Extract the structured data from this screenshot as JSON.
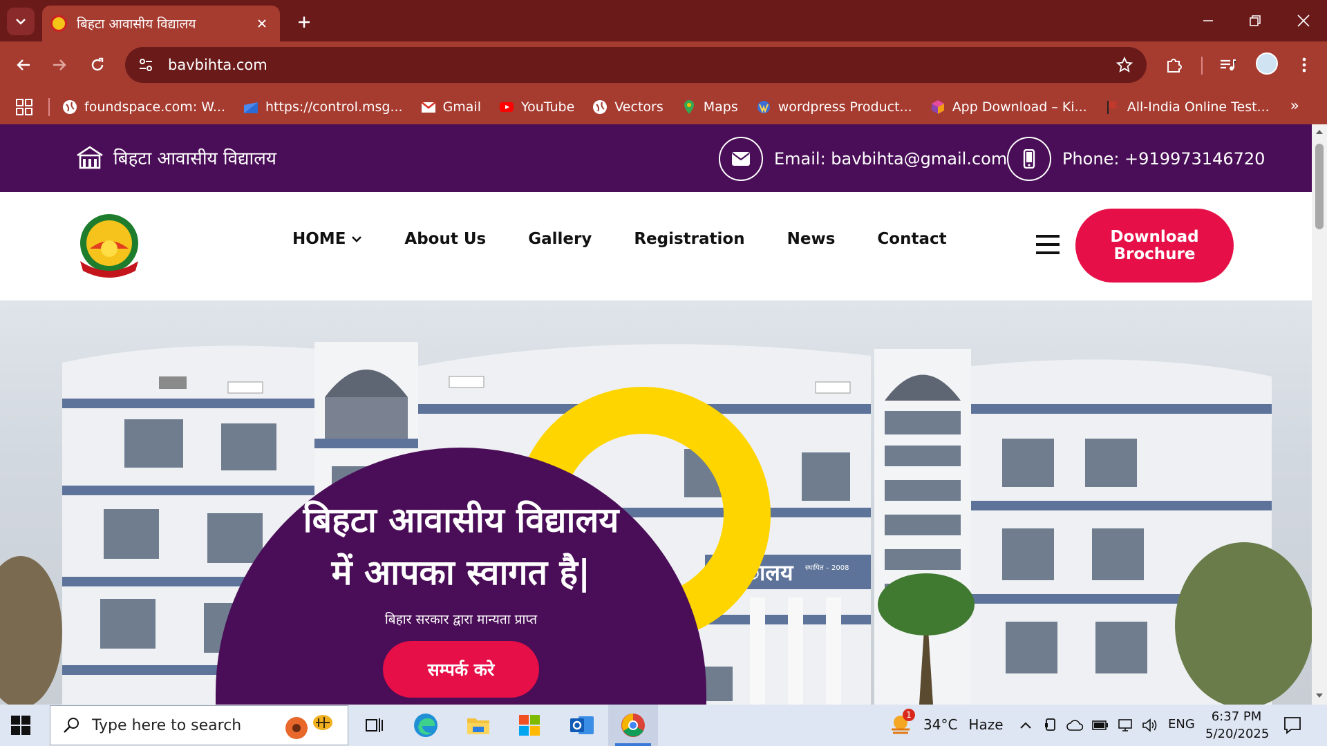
{
  "browser": {
    "tab": {
      "title": "बिहटा आवासीय विद्यालय"
    },
    "url": "bavbihta.com",
    "bookmarks": [
      {
        "label": "foundspace.com: W...",
        "icon": "globe-icon"
      },
      {
        "label": "https://control.msg...",
        "icon": "folder-icon"
      },
      {
        "label": "Gmail",
        "icon": "gmail-icon"
      },
      {
        "label": "YouTube",
        "icon": "youtube-icon"
      },
      {
        "label": "Vectors",
        "icon": "globe-icon"
      },
      {
        "label": "Maps",
        "icon": "maps-icon"
      },
      {
        "label": "wordpress Product...",
        "icon": "wordpress-icon"
      },
      {
        "label": "App Download – Ki...",
        "icon": "app-icon"
      },
      {
        "label": "All-India Online Test...",
        "icon": "flag-icon"
      }
    ],
    "bookmarks_more": "»"
  },
  "site": {
    "topbar": {
      "brand": "बिहटा आवासीय विद्यालय",
      "email": "Email: bavbihta@gmail.com",
      "phone": "Phone: +919973146720"
    },
    "nav": {
      "items": [
        "HOME",
        "About Us",
        "Gallery",
        "Registration",
        "News",
        "Contact"
      ],
      "brochure_line1": "Download",
      "brochure_line2": "Brochure"
    },
    "hero": {
      "title_line1": "बिहटा आवासीय विद्यालय",
      "title_line2": "में आपका स्वागत है|",
      "subtitle": "बिहार सरकार द्वारा मान्यता प्राप्त",
      "cta": "सम्पर्क करे",
      "building_sign": "ालय",
      "building_sign_small": "स्थापित – 2008"
    }
  },
  "taskbar": {
    "search_placeholder": "Type here to search",
    "weather_temp": "34°C",
    "weather_desc": "Haze",
    "weather_badge": "1",
    "language": "ENG",
    "time": "6:37 PM",
    "date": "5/20/2025"
  },
  "colors": {
    "chrome_dark": "#6b1a1a",
    "chrome_light": "#a63b30",
    "site_purple": "#4a0d57",
    "accent_red": "#e60f47",
    "accent_yellow": "#ffd500"
  }
}
